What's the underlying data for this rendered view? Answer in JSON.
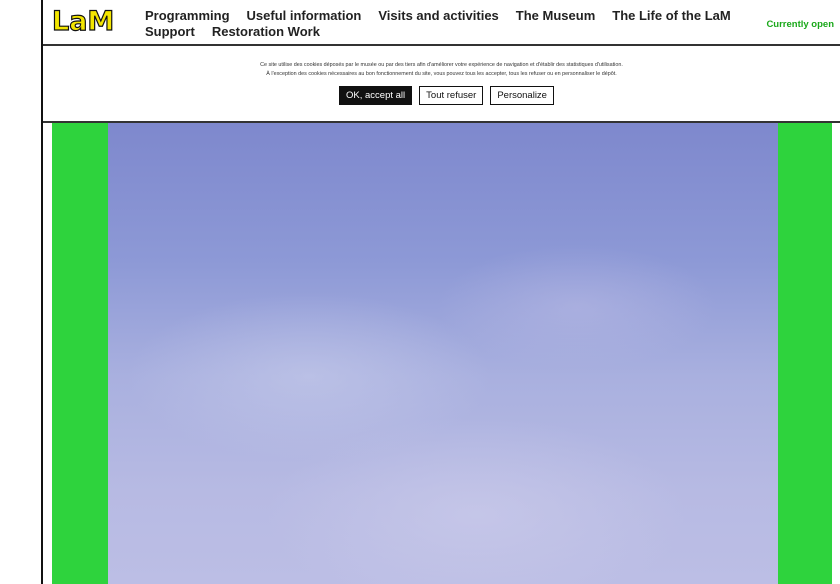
{
  "header": {
    "logo_text": "LaM",
    "nav_items": [
      {
        "label": "Programming"
      },
      {
        "label": "Useful information"
      },
      {
        "label": "Visits and activities"
      },
      {
        "label": "The Museum"
      },
      {
        "label": "The Life of the LaM"
      },
      {
        "label": "Support"
      },
      {
        "label": "Restoration Work"
      }
    ],
    "status_text": "Currently open"
  },
  "cookie_banner": {
    "text_line1": "Ce site utilise des cookies déposés par le musée ou par des tiers afin d'améliorer votre expérience de navigation et d'établir des statistiques d'utilisation.",
    "text_line2": "À l'exception des cookies nécessaires au bon fonctionnement du site, vous pouvez tous les accepter, tous les refuser ou en personnaliser le dépôt.",
    "accept_label": "OK, accept all",
    "refuse_label": "Tout refuser",
    "personalize_label": "Personalize"
  },
  "colors": {
    "logo_yellow": "#f4e600",
    "status_green": "#1aa81a",
    "content_green": "#2ed33d",
    "sky_blue": "#8d99d6"
  }
}
